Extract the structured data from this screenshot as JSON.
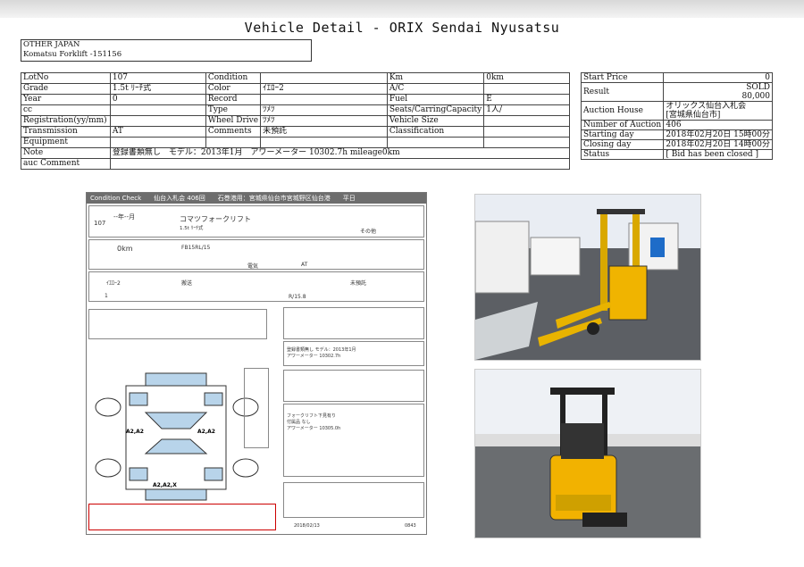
{
  "page": {
    "title": "Vehicle Detail - ORIX Sendai Nyusatsu"
  },
  "vehicle": {
    "make": "OTHER JAPAN",
    "model_line": "Komatsu Forklift -151156"
  },
  "spec_rows": [
    [
      "LotNo",
      "107",
      "Condition",
      "",
      "Km",
      "0km"
    ],
    [
      "Grade",
      "1.5t ﾘｰﾁ式",
      "Color",
      "ｲｴﾛｰ2",
      "A/C",
      ""
    ],
    [
      "Year",
      "0",
      "Record",
      "",
      "Fuel",
      "E"
    ],
    [
      "cc",
      "",
      "Type",
      "ﾂﾒﾂ",
      "Seats/CarringCapacity",
      "1人/"
    ],
    [
      "Registration(yy/mm)",
      "",
      "Wheel Drive",
      "ﾂﾒﾂ",
      "Vehicle Size",
      ""
    ],
    [
      "Transmission",
      "AT",
      "Comments",
      "未預託",
      "Classification",
      ""
    ],
    [
      "Equipment",
      "",
      "",
      "",
      "",
      ""
    ]
  ],
  "note": {
    "label": "Note",
    "value": "登録書類無し　モデル：2013年1月　アワーメーター 10302.7h mileage0km"
  },
  "auc_comment": {
    "label": "auc Comment",
    "value": ""
  },
  "auction": [
    {
      "label": "Start Price",
      "value": "0"
    },
    {
      "label": "Result",
      "value": "SOLD\n80,000"
    },
    {
      "label": "Auction House",
      "value": "オリックス仙台入札会\n[宮城県仙台市]"
    },
    {
      "label": "Number of Auction",
      "value": "406"
    },
    {
      "label": "Starting day",
      "value": "2018年02月20日 15時00分"
    },
    {
      "label": "Closing day",
      "value": "2018年02月20日 14時00分"
    },
    {
      "label": "Status",
      "value": "[ Bid has been closed ]"
    }
  ],
  "sheet": {
    "hdr1": "Condition Check",
    "hdr2": "仙台入札会 406回",
    "hdr3": "石巻港用：宮城県仙台市宮城野区仙台港",
    "hdr4": "平日",
    "lot": "107",
    "year": "--年--月",
    "maker": "コマツフォークリフト",
    "grade": "1.5t ﾘｰﾁ式",
    "other": "その他",
    "km": "0km",
    "model": "FB15RL/15",
    "mission": "AT",
    "color": "ｲｴﾛｰ2",
    "fuel": "電気",
    "dispatch": "搬送",
    "owner": "未預託",
    "seat": "1",
    "score": "R/15.8",
    "chassis_note": "登録書類無し モデル：2013年1月\nアワーメーター 10302.7h",
    "equip_note": "フォークリフト下見有り\n付属品 なし\nアワーメーター 10305.0h",
    "date": "2018/02/13",
    "page": "0843",
    "marks": [
      "A2,A2",
      "A2,A2",
      "A2,A2,X"
    ]
  }
}
